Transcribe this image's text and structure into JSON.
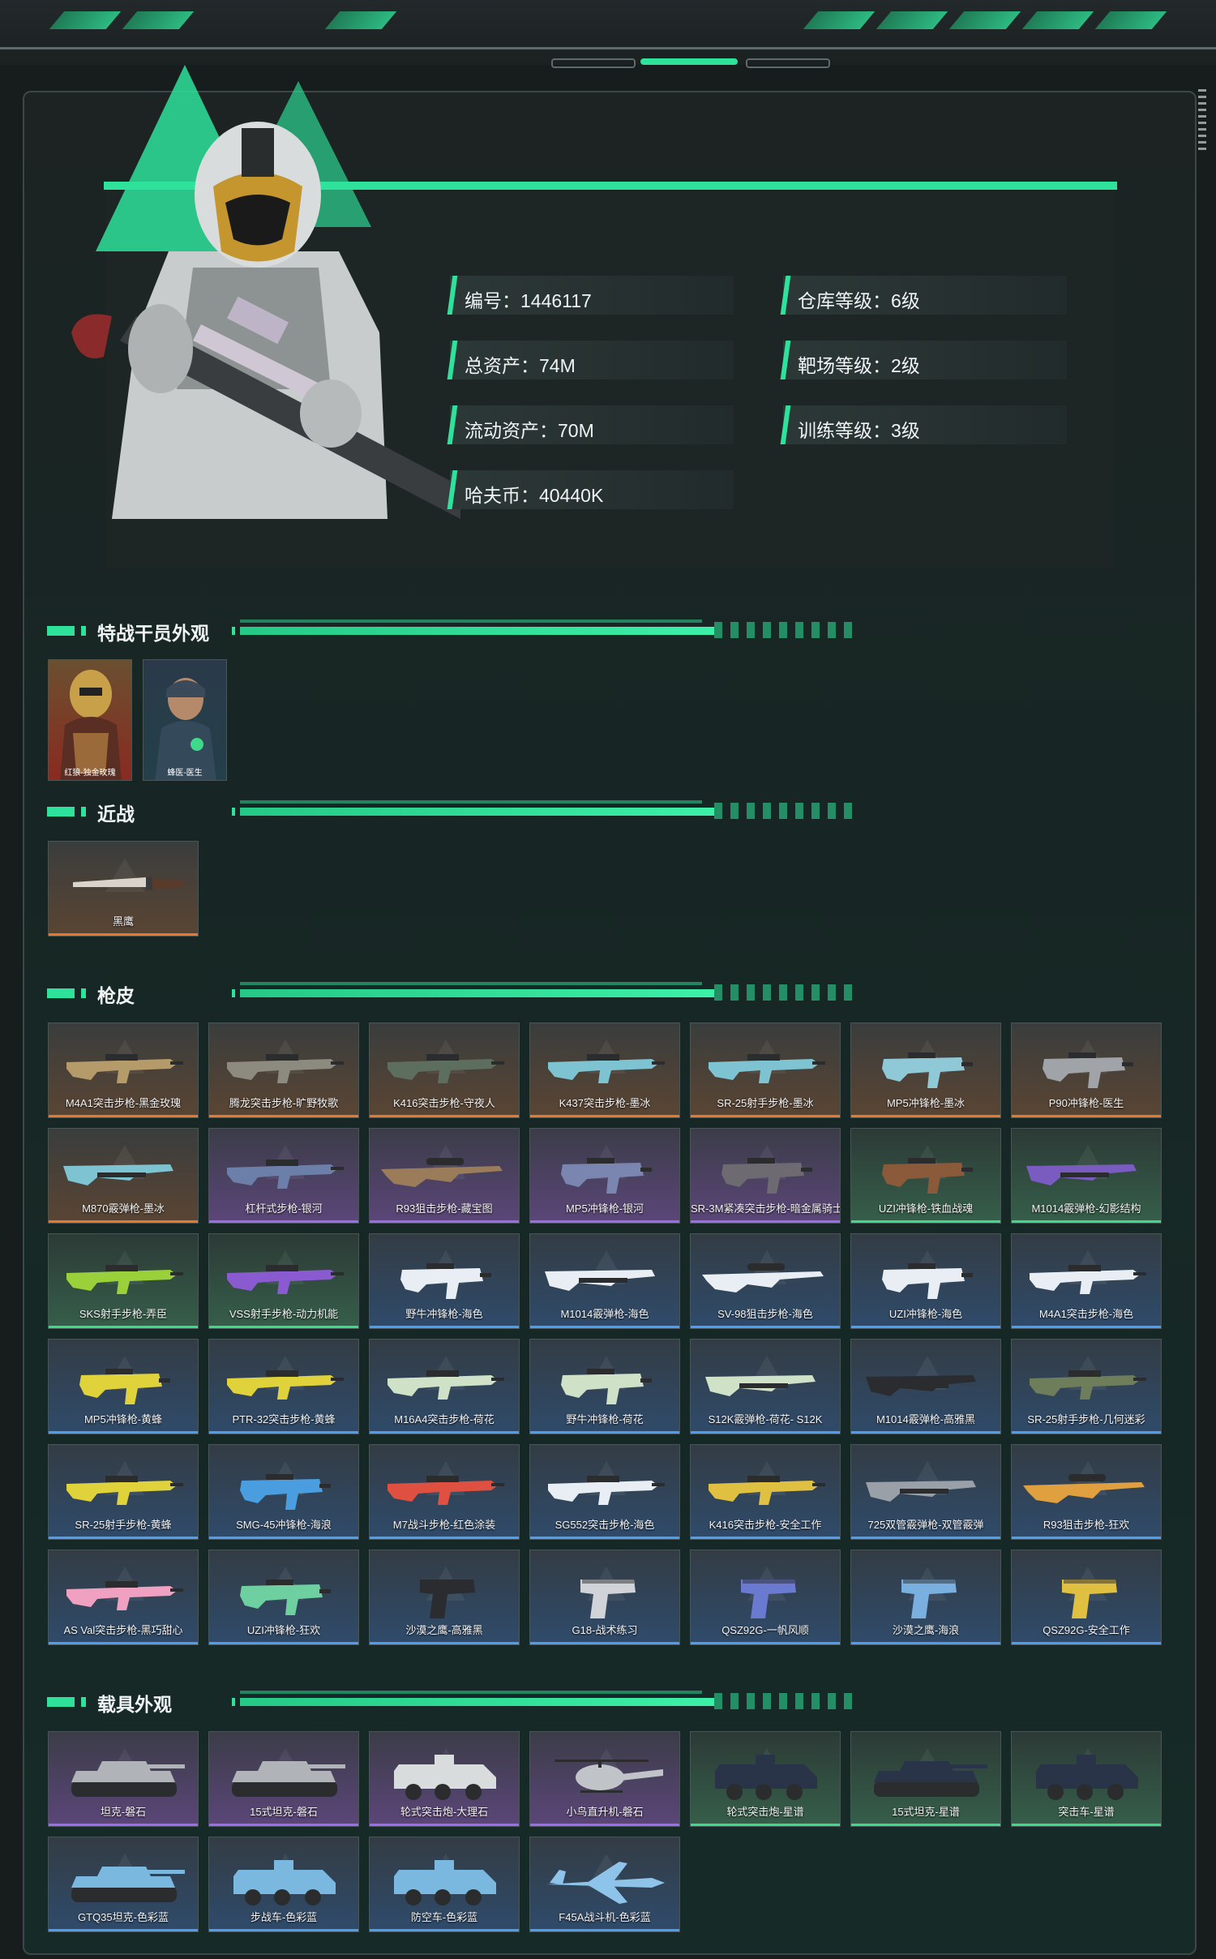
{
  "colors": {
    "accent": "#2ee29b",
    "orange": "#e8782e",
    "purple": "#9b6cf0",
    "green": "#3fd98a",
    "blue": "#4f9df0"
  },
  "profile": {
    "left": [
      {
        "label": "编号：1446117"
      },
      {
        "label": "总资产：74M"
      },
      {
        "label": "流动资产：70M"
      },
      {
        "label": "哈夫币：40440K"
      }
    ],
    "right": [
      {
        "label": "仓库等级：6级"
      },
      {
        "label": "靶场等级：2级"
      },
      {
        "label": "训练等级：3级"
      }
    ]
  },
  "sections": {
    "operators": {
      "title": "特战干员外观",
      "items": [
        {
          "name": "红狼-独金玫瑰",
          "rarity": "orange"
        },
        {
          "name": "蜂医-医生",
          "rarity": "blue"
        }
      ]
    },
    "melee": {
      "title": "近战",
      "items": [
        {
          "name": "黑鹰",
          "rarity": "orange",
          "icon": "knife-icon"
        }
      ]
    },
    "guns": {
      "title": "枪皮",
      "items": [
        {
          "name": "M4A1突击步枪-黑金玫瑰",
          "rarity": "orange",
          "icon": "rifle-icon",
          "color": "#b59a6a"
        },
        {
          "name": "腾龙突击步枪-旷野牧歌",
          "rarity": "orange",
          "icon": "rifle-icon",
          "color": "#8d8a80"
        },
        {
          "name": "K416突击步枪-守夜人",
          "rarity": "orange",
          "icon": "rifle-icon",
          "color": "#5d6d5e"
        },
        {
          "name": "K437突击步枪-墨冰",
          "rarity": "orange",
          "icon": "rifle-icon",
          "color": "#7ec3d2"
        },
        {
          "name": "SR-25射手步枪-墨冰",
          "rarity": "orange",
          "icon": "rifle-icon",
          "color": "#7ec3d2"
        },
        {
          "name": "MP5冲锋枪-墨冰",
          "rarity": "orange",
          "icon": "smg-icon",
          "color": "#8fc8d6"
        },
        {
          "name": "P90冲锋枪-医生",
          "rarity": "orange",
          "icon": "smg-icon",
          "color": "#a0a4a8"
        },
        {
          "name": "M870霰弹枪-墨冰",
          "rarity": "orange",
          "icon": "shotgun-icon",
          "color": "#7ec3d2"
        },
        {
          "name": "杠杆式步枪-银河",
          "rarity": "purple",
          "icon": "rifle-icon",
          "color": "#6c7fa8"
        },
        {
          "name": "R93狙击步枪-藏宝图",
          "rarity": "purple",
          "icon": "sniper-icon",
          "color": "#9a7b5a"
        },
        {
          "name": "MP5冲锋枪-银河",
          "rarity": "purple",
          "icon": "smg-icon",
          "color": "#7b86b0"
        },
        {
          "name": "SR-3M紧凑突击步枪-暗金属骑士",
          "rarity": "purple",
          "icon": "smg-icon",
          "color": "#6d6a72"
        },
        {
          "name": "UZI冲锋枪-铁血战魂",
          "rarity": "green",
          "icon": "smg-icon",
          "color": "#8a5a3a"
        },
        {
          "name": "M1014霰弹枪-幻影结构",
          "rarity": "green",
          "icon": "shotgun-icon",
          "color": "#7a5cc0"
        },
        {
          "name": "SKS射手步枪-弄臣",
          "rarity": "green",
          "icon": "rifle-icon",
          "color": "#9ad13a"
        },
        {
          "name": "VSS射手步枪-动力机能",
          "rarity": "green",
          "icon": "rifle-icon",
          "color": "#8a5ad0"
        },
        {
          "name": "野牛冲锋枪-海色",
          "rarity": "blue",
          "icon": "smg-icon",
          "color": "#e8eef4"
        },
        {
          "name": "M1014霰弹枪-海色",
          "rarity": "blue",
          "icon": "shotgun-icon",
          "color": "#e8eef4"
        },
        {
          "name": "SV-98狙击步枪-海色",
          "rarity": "blue",
          "icon": "sniper-icon",
          "color": "#e8eef4"
        },
        {
          "name": "UZI冲锋枪-海色",
          "rarity": "blue",
          "icon": "smg-icon",
          "color": "#e8eef4"
        },
        {
          "name": "M4A1突击步枪-海色",
          "rarity": "blue",
          "icon": "rifle-icon",
          "color": "#e8eef4"
        },
        {
          "name": "MP5冲锋枪-黄蜂",
          "rarity": "blue",
          "icon": "smg-icon",
          "color": "#e0d23a"
        },
        {
          "name": "PTR-32突击步枪-黄蜂",
          "rarity": "blue",
          "icon": "rifle-icon",
          "color": "#e0d23a"
        },
        {
          "name": "M16A4突击步枪-荷花",
          "rarity": "blue",
          "icon": "rifle-icon",
          "color": "#cfe2c8"
        },
        {
          "name": "野牛冲锋枪-荷花",
          "rarity": "blue",
          "icon": "smg-icon",
          "color": "#cfe2c8"
        },
        {
          "name": "S12K霰弹枪-荷花- S12K",
          "rarity": "blue",
          "icon": "shotgun-icon",
          "color": "#cfe2c8"
        },
        {
          "name": "M1014霰弹枪-高雅黑",
          "rarity": "blue",
          "icon": "shotgun-icon",
          "color": "#2a2c30"
        },
        {
          "name": "SR-25射手步枪-几何迷彩",
          "rarity": "blue",
          "icon": "rifle-icon",
          "color": "#6e7d5a"
        },
        {
          "name": "SR-25射手步枪-黄蜂",
          "rarity": "blue",
          "icon": "rifle-icon",
          "color": "#e0d23a"
        },
        {
          "name": "SMG-45冲锋枪-海浪",
          "rarity": "blue",
          "icon": "smg-icon",
          "color": "#4a9ee0"
        },
        {
          "name": "M7战斗步枪-红色涂装",
          "rarity": "blue",
          "icon": "rifle-icon",
          "color": "#e05040"
        },
        {
          "name": "SG552突击步枪-海色",
          "rarity": "blue",
          "icon": "rifle-icon",
          "color": "#e8eef4"
        },
        {
          "name": "K416突击步枪-安全工作",
          "rarity": "blue",
          "icon": "rifle-icon",
          "color": "#e0c040"
        },
        {
          "name": "725双管霰弹枪-双管霰弹",
          "rarity": "blue",
          "icon": "shotgun-icon",
          "color": "#9aa0a8"
        },
        {
          "name": "R93狙击步枪-狂欢",
          "rarity": "blue",
          "icon": "sniper-icon",
          "color": "#e0a040"
        },
        {
          "name": "AS Val突击步枪-黑巧甜心",
          "rarity": "blue",
          "icon": "rifle-icon",
          "color": "#f0a0c0"
        },
        {
          "name": "UZI冲锋枪-狂欢",
          "rarity": "blue",
          "icon": "smg-icon",
          "color": "#6ed0a0"
        },
        {
          "name": "沙漠之鹰-高雅黑",
          "rarity": "blue",
          "icon": "pistol-icon",
          "color": "#2a2c30"
        },
        {
          "name": "G18-战术练习",
          "rarity": "blue",
          "icon": "pistol-icon",
          "color": "#d0d4d8"
        },
        {
          "name": "QSZ92G-一帆风顺",
          "rarity": "blue",
          "icon": "pistol-icon",
          "color": "#6a7ad0"
        },
        {
          "name": "沙漠之鹰-海浪",
          "rarity": "blue",
          "icon": "pistol-icon",
          "color": "#7ab0e0"
        },
        {
          "name": "QSZ92G-安全工作",
          "rarity": "blue",
          "icon": "pistol-icon",
          "color": "#e0c040"
        }
      ]
    },
    "vehicles": {
      "title": "载具外观",
      "items": [
        {
          "name": "坦克-磐石",
          "rarity": "purple",
          "icon": "tank-icon",
          "color": "#b0b4b8"
        },
        {
          "name": "15式坦克-磐石",
          "rarity": "purple",
          "icon": "tank-icon",
          "color": "#b0b4b8"
        },
        {
          "name": "轮式突击炮-大理石",
          "rarity": "purple",
          "icon": "apc-icon",
          "color": "#d8dcdc"
        },
        {
          "name": "小鸟直升机-磐石",
          "rarity": "purple",
          "icon": "helicopter-icon",
          "color": "#c0c4c8"
        },
        {
          "name": "轮式突击炮-星谱",
          "rarity": "green",
          "icon": "apc-icon",
          "color": "#2a3448"
        },
        {
          "name": "15式坦克-星谱",
          "rarity": "green",
          "icon": "tank-icon",
          "color": "#2a3448"
        },
        {
          "name": "突击车-星谱",
          "rarity": "green",
          "icon": "apc-icon",
          "color": "#2a3448"
        },
        {
          "name": "GTQ35坦克-色彩蓝",
          "rarity": "blue",
          "icon": "tank-icon",
          "color": "#7ab8e0"
        },
        {
          "name": "步战车-色彩蓝",
          "rarity": "blue",
          "icon": "apc-icon",
          "color": "#7ab8e0"
        },
        {
          "name": "防空车-色彩蓝",
          "rarity": "blue",
          "icon": "apc-icon",
          "color": "#7ab8e0"
        },
        {
          "name": "F45A战斗机-色彩蓝",
          "rarity": "blue",
          "icon": "jet-icon",
          "color": "#8ec4ea"
        }
      ]
    }
  }
}
